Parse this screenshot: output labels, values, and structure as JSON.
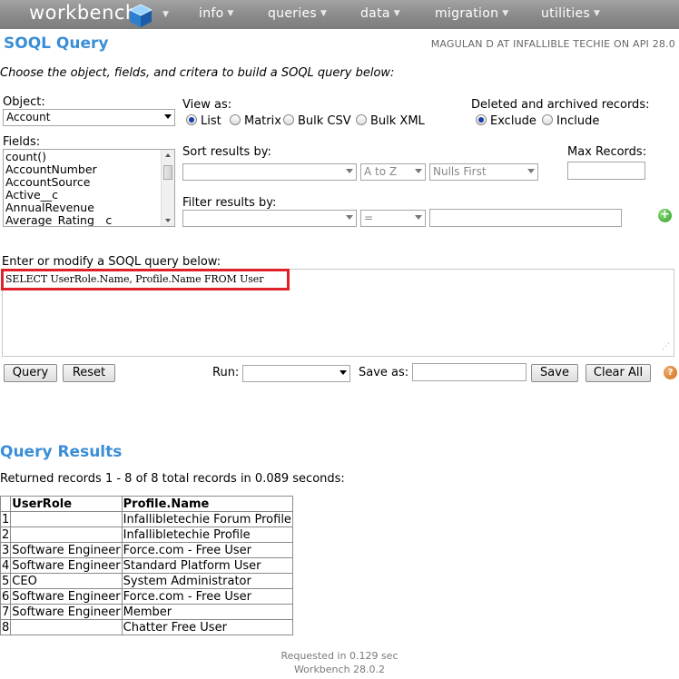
{
  "navbar": {
    "logo": "workbench",
    "menus": [
      "info",
      "queries",
      "data",
      "migration",
      "utilities"
    ]
  },
  "header": {
    "title": "SOQL Query",
    "user": "MAGULAN D AT INFALLIBLE TECHIE ON API 28.0"
  },
  "instructions": "Choose the object, fields, and critera to build a SOQL query below:",
  "object": {
    "label": "Object:",
    "value": "Account"
  },
  "view_as": {
    "label": "View as:",
    "options": [
      "List",
      "Matrix",
      "Bulk CSV",
      "Bulk XML"
    ],
    "selected": "List"
  },
  "deleted": {
    "label": "Deleted and archived records:",
    "options": [
      "Exclude",
      "Include"
    ],
    "selected": "Exclude"
  },
  "fields": {
    "label": "Fields:",
    "items": [
      "count()",
      "AccountNumber",
      "AccountSource",
      "Active__c",
      "AnnualRevenue",
      "Average_Rating__c"
    ]
  },
  "sort": {
    "label": "Sort results by:",
    "field": "",
    "direction": "A to Z",
    "nulls": "Nulls First"
  },
  "max_records": {
    "label": "Max Records:",
    "value": ""
  },
  "filter": {
    "label": "Filter results by:",
    "field": "",
    "operator": "=",
    "value": ""
  },
  "query": {
    "label": "Enter or modify a SOQL query below:",
    "text": "SELECT UserRole.Name, Profile.Name FROM User"
  },
  "actions": {
    "query_button": "Query",
    "reset_button": "Reset",
    "run_label": "Run:",
    "run_value": "",
    "save_as_label": "Save as:",
    "save_as_value": "",
    "save_button": "Save",
    "clear_all_button": "Clear All"
  },
  "results": {
    "title": "Query Results",
    "summary": "Returned records 1 - 8 of 8 total records in 0.089 seconds:",
    "columns": [
      "UserRole",
      "Profile.Name"
    ],
    "rows": [
      [
        "1",
        "",
        "Infallibletechie Forum Profile"
      ],
      [
        "2",
        "",
        "Infallibletechie Profile"
      ],
      [
        "3",
        "Software Engineer",
        "Force.com - Free User"
      ],
      [
        "4",
        "Software Engineer",
        "Standard Platform User"
      ],
      [
        "5",
        "CEO",
        "System Administrator"
      ],
      [
        "6",
        "Software Engineer",
        "Force.com - Free User"
      ],
      [
        "7",
        "Software Engineer",
        "Member"
      ],
      [
        "8",
        "",
        "Chatter Free User"
      ]
    ]
  },
  "footer": {
    "requested": "Requested in 0.129 sec",
    "version": "Workbench 28.0.2"
  },
  "colors": {
    "accent": "#3a8ed6",
    "navbar": "#8a8a8a",
    "highlight": "#e0202a"
  }
}
